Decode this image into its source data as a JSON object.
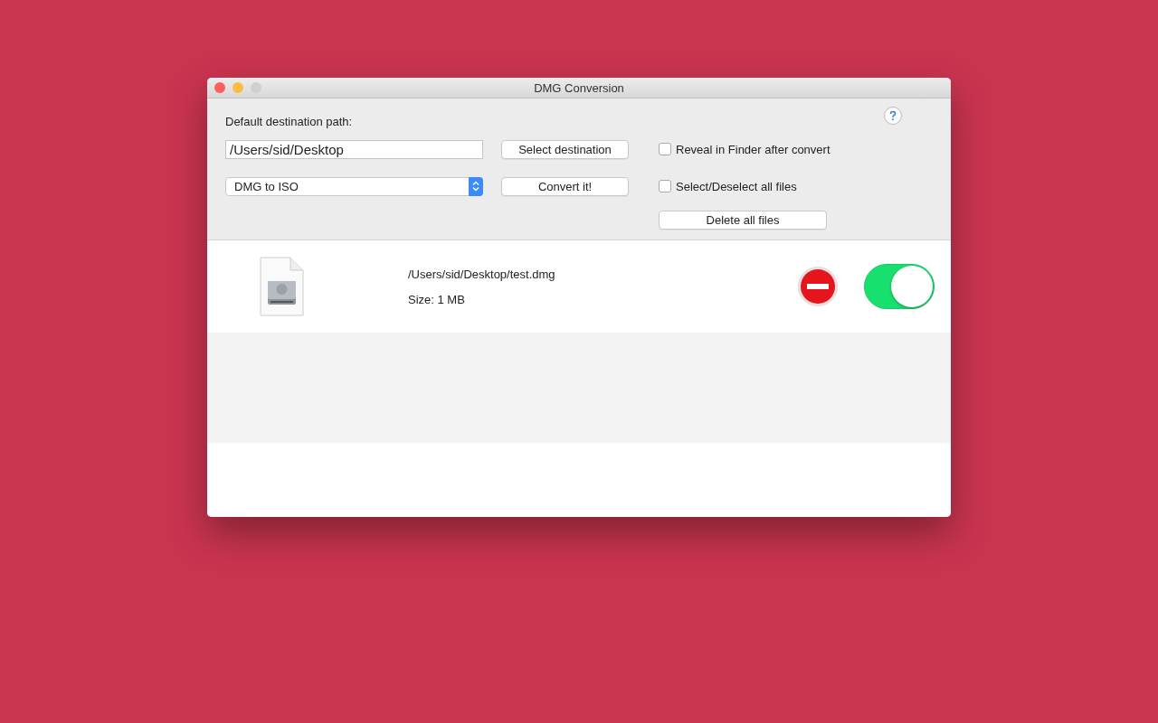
{
  "window": {
    "title": "DMG Conversion"
  },
  "destination": {
    "label": "Default destination path:",
    "value": "/Users/sid/Desktop"
  },
  "format_select": {
    "value": "DMG to ISO"
  },
  "buttons": [
    {
      "label": "Select destination"
    },
    {
      "label": "Convert it!"
    },
    {
      "label": "Delete all files"
    }
  ],
  "options": [
    {
      "label": "Reveal in Finder after convert",
      "checked": false
    },
    {
      "label": "Select/Deselect all files",
      "checked": false
    }
  ],
  "files": [
    {
      "path": "/Users/sid/Desktop/test.dmg",
      "size": "Size: 1 MB",
      "on": true
    }
  ]
}
